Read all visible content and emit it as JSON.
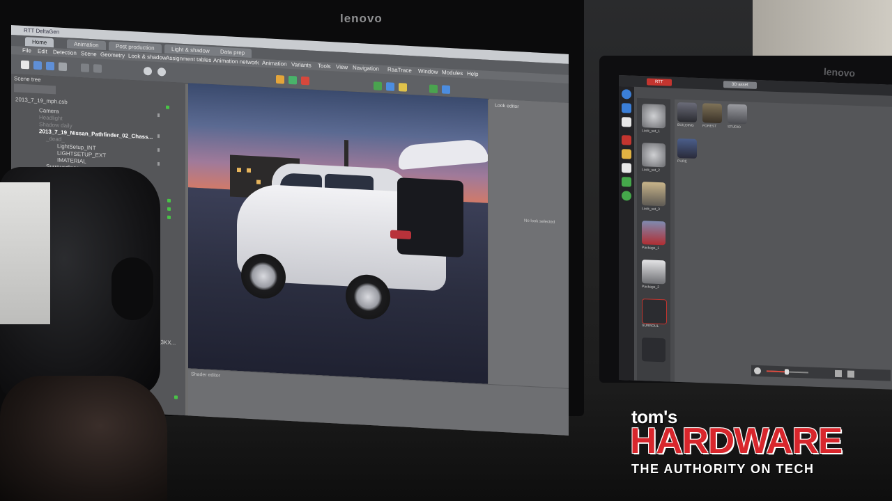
{
  "monitors": {
    "left_brand": "lenovo",
    "right_brand": "lenovo"
  },
  "app": {
    "window_title": "RTT DeltaGen",
    "tabs": [
      {
        "label": "Home",
        "active": true
      },
      {
        "label": "Animation",
        "active": false
      },
      {
        "label": "Post production",
        "active": false
      },
      {
        "label": "Light & shadow",
        "active": false
      },
      {
        "label": "Data prep",
        "active": false
      }
    ],
    "menu": [
      "File",
      "Edit",
      "Detection",
      "Scene",
      "Geometry",
      "Look & shadow",
      "Assignment tables",
      "Animation network",
      "Animation",
      "Variants",
      "Tools",
      "View",
      "Navigation",
      "RaaTrace",
      "Window",
      "Modules",
      "Help"
    ],
    "scene_tree": {
      "header": "Scene tree",
      "file_label": "2013_7_19_mph.csb",
      "items": [
        {
          "label": "Camera",
          "style": "normal"
        },
        {
          "label": "Headlight",
          "style": "dim"
        },
        {
          "label": "Shadow daily",
          "style": "dim"
        },
        {
          "label": "2013_7_19_Nissan_Pathfinder_02_Chass...",
          "style": "bold"
        },
        {
          "label": "_dead_",
          "style": "dim"
        },
        {
          "label": "LightSetup_INT",
          "style": "normal"
        },
        {
          "label": "LIGHTSETUP_EXT",
          "style": "normal"
        },
        {
          "label": "IMATERIAL",
          "style": "normal"
        },
        {
          "label": "Surroundings",
          "style": "normal"
        }
      ],
      "partial_item": "OR_R2012_3KX..."
    },
    "right_panel": {
      "label": "Look editor",
      "text": "No look selected"
    },
    "bottom_label": "Shader editor"
  },
  "library": {
    "tabs": [
      {
        "label": "RTT",
        "style": "red"
      },
      {
        "label": "3D asset",
        "style": "grey"
      }
    ],
    "list_items": [
      {
        "caption": "Look_set_1",
        "kind": "sphere"
      },
      {
        "caption": "Look_set_2",
        "kind": "sphere"
      },
      {
        "caption": "Look_set_3",
        "kind": "scene"
      },
      {
        "caption": "Package_1",
        "kind": "car"
      },
      {
        "caption": "Package_2",
        "kind": "car"
      },
      {
        "caption": "SURROUL",
        "kind": "arrow"
      },
      {
        "caption": "",
        "kind": "arrow"
      }
    ],
    "grid_items": [
      {
        "caption": "BUILDING"
      },
      {
        "caption": "FOREST"
      },
      {
        "caption": "STUDIO"
      },
      {
        "caption": "PURE"
      }
    ]
  },
  "watermark": {
    "brand_small": "tom's",
    "brand_large": "HARDWARE",
    "tagline": "THE AUTHORITY ON TECH",
    "red": "#d8262c"
  }
}
